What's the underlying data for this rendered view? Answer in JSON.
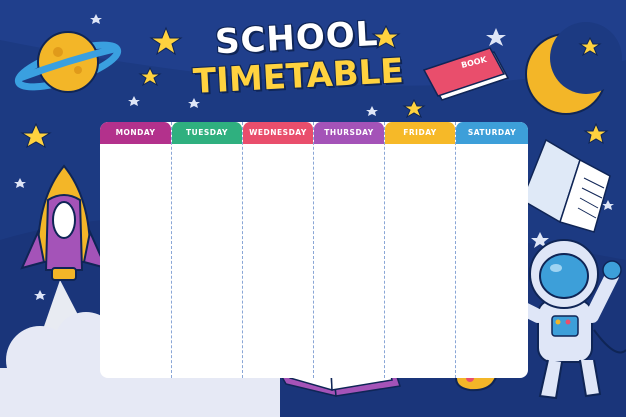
{
  "title": {
    "line1": "SCHOOL",
    "line2": "TIMETABLE"
  },
  "days": [
    {
      "label": "MONDAY",
      "color": "#b3318c"
    },
    {
      "label": "TUESDAY",
      "color": "#2fb07f"
    },
    {
      "label": "WEDNESDAY",
      "color": "#e94e6c"
    },
    {
      "label": "THURSDAY",
      "color": "#a453b8"
    },
    {
      "label": "FRIDAY",
      "color": "#f6b928"
    },
    {
      "label": "SATURDAY",
      "color": "#3d9fd9"
    }
  ],
  "book_label": "BOOK",
  "colors": {
    "background": "#1c3a82",
    "star": "#ffd23f",
    "cloud": "#e6e9f5"
  },
  "icons": [
    "planet-icon",
    "moon-icon",
    "book-icon",
    "rocket-icon",
    "astronaut-icon",
    "open-book-icon",
    "paint-palette-icon",
    "star-icon"
  ]
}
